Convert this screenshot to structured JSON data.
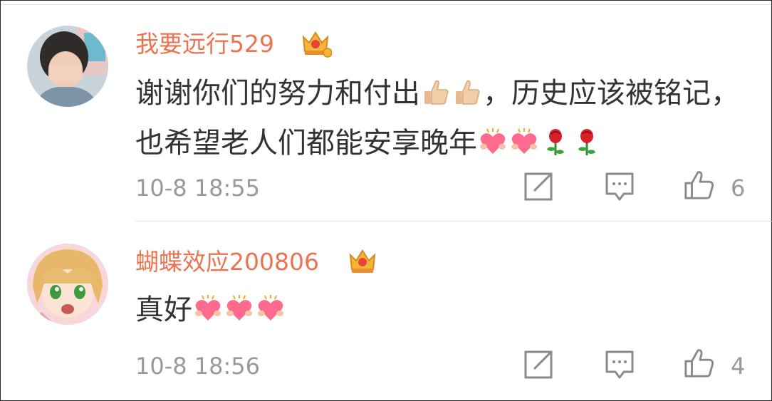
{
  "colors": {
    "username": "#eb7350",
    "text": "#333333",
    "meta": "#999999",
    "divider": "#e4e4e4"
  },
  "comments": [
    {
      "username": "我要远行529",
      "badge_icon": "crown-vip-badge-icon",
      "text_part1": "谢谢你们的努力和付出",
      "text_part2": "，历史应该被铭记，也希望老人们都能安享晚年",
      "emojis": [
        "thumbs-up",
        "thumbs-up",
        "heart-hug",
        "heart-hug",
        "rose",
        "rose"
      ],
      "timestamp": "10-8 18:55",
      "like_count": "6"
    },
    {
      "username": "蝴蝶效应200806",
      "badge_icon": "crown-vip-badge-icon",
      "text_part1": "真好",
      "emojis": [
        "heart-hug",
        "heart-hug",
        "heart-hug"
      ],
      "timestamp": "10-8 18:56",
      "like_count": "4"
    }
  ]
}
